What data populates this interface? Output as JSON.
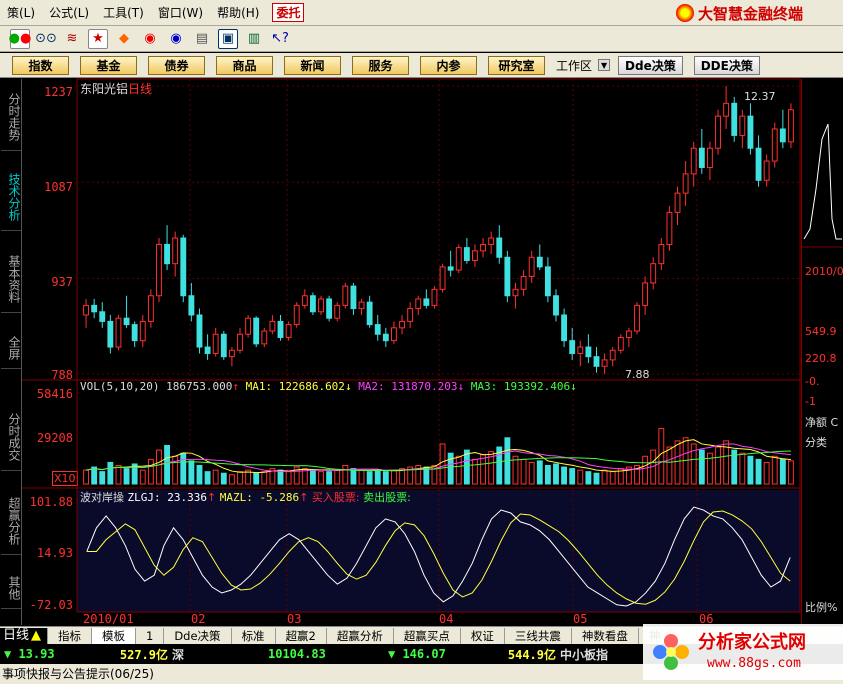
{
  "menubar": {
    "items": [
      "策(L)",
      "公式(L)",
      "工具(T)",
      "窗口(W)",
      "帮助(H)"
    ],
    "entrust": "委托",
    "brand": "大智慧金融终端"
  },
  "toolbar": {
    "icons": [
      "rgb-icon",
      "binoculars-icon",
      "signal-icon",
      "star-icon",
      "diamond-icon",
      "red-circle-icon",
      "blue-circle-icon",
      "book-icon",
      "window-icon",
      "cards-icon",
      "help-icon"
    ]
  },
  "navbar": {
    "buttons": [
      "指数",
      "基金",
      "债券",
      "商品",
      "新闻",
      "服务",
      "内参",
      "研究室"
    ],
    "workzone": "工作区",
    "dde1": "Dde决策",
    "dde2": "DDE决策"
  },
  "sidebar": {
    "tabs": [
      {
        "label": "分时走势",
        "active": false
      },
      {
        "label": "技术分析",
        "active": true
      },
      {
        "label": "基本资料",
        "active": false
      },
      {
        "label": "全屏",
        "active": false
      },
      {
        "label": "分时成交",
        "active": false
      },
      {
        "label": "超赢分析",
        "active": false
      },
      {
        "label": "其他",
        "active": false
      }
    ]
  },
  "stock": {
    "name": "东阳光铝",
    "period": "日线",
    "high_label": "12.37",
    "low_label": "7.88"
  },
  "price_axis": [
    "1237",
    "1087",
    "937",
    "788"
  ],
  "vol_axis": [
    "58416",
    "29208"
  ],
  "vol_unit": "X10",
  "ind_axis": [
    "101.88",
    "14.93",
    "-72.03"
  ],
  "vol_legend": {
    "name": "VOL(5,10,20)",
    "value": "186753.000",
    "ma1": "MA1: 122686.602",
    "ma2": "MA2: 131870.203",
    "ma3": "MA3: 193392.406",
    "up": "↑",
    "down": "↓"
  },
  "ind_legend": {
    "name": "波对岸操",
    "zlgj": "ZLGJ: 23.336",
    "mazl": "MAZL: -5.286",
    "buy": "买入股票:",
    "sell": "卖出股票:",
    "up": "↑"
  },
  "xaxis": [
    "2010/01",
    "02",
    "03",
    "04",
    "05",
    "06"
  ],
  "rightpanel": {
    "date": "2010/0",
    "v1": "549.9",
    "v2": "220.8",
    "v3": "-0.",
    "v4": "-1",
    "net": "净额 C",
    "cls": "分类",
    "ratio": "比例%"
  },
  "bottomtabs": {
    "dayline": "日线",
    "items": [
      "指标",
      "模板",
      "1",
      "Dde决策",
      "标准",
      "超赢2",
      "超赢分析",
      "超赢买点",
      "权证",
      "三线共震",
      "神数看盘",
      "神"
    ]
  },
  "statusbar": {
    "v1": "▼ 13.93",
    "v2": "527.9亿",
    "m1": "深",
    "v3": "10104.83",
    "v4": "▼ 146.07",
    "v5": "544.9亿",
    "m2": "中小板指"
  },
  "notice": "事项快报与公告提示(06/25)",
  "watermark": {
    "title": "分析家公式网",
    "url": "www.88gs.com"
  },
  "chart_data": {
    "type": "candlestick",
    "title": "东阳光铝 日线",
    "ylim": [
      788,
      1237
    ],
    "price_high": 12.37,
    "price_low": 7.88,
    "x_tick_labels": [
      "2010/01",
      "02",
      "03",
      "04",
      "05",
      "06"
    ],
    "ohlc": [
      [
        880,
        905,
        860,
        895
      ],
      [
        895,
        905,
        875,
        885
      ],
      [
        885,
        900,
        860,
        870
      ],
      [
        870,
        880,
        820,
        830
      ],
      [
        830,
        880,
        825,
        875
      ],
      [
        875,
        910,
        860,
        865
      ],
      [
        865,
        870,
        830,
        840
      ],
      [
        840,
        880,
        830,
        870
      ],
      [
        870,
        920,
        860,
        910
      ],
      [
        910,
        1000,
        900,
        990
      ],
      [
        990,
        1020,
        950,
        960
      ],
      [
        960,
        1010,
        940,
        1000
      ],
      [
        1000,
        1005,
        900,
        910
      ],
      [
        910,
        930,
        870,
        880
      ],
      [
        880,
        890,
        820,
        830
      ],
      [
        830,
        850,
        810,
        820
      ],
      [
        820,
        860,
        815,
        850
      ],
      [
        850,
        855,
        810,
        815
      ],
      [
        815,
        830,
        800,
        825
      ],
      [
        825,
        860,
        820,
        850
      ],
      [
        850,
        880,
        845,
        875
      ],
      [
        875,
        878,
        830,
        835
      ],
      [
        835,
        860,
        830,
        855
      ],
      [
        855,
        880,
        850,
        870
      ],
      [
        870,
        880,
        840,
        845
      ],
      [
        845,
        870,
        840,
        865
      ],
      [
        865,
        900,
        860,
        895
      ],
      [
        895,
        920,
        890,
        910
      ],
      [
        910,
        915,
        880,
        885
      ],
      [
        885,
        910,
        880,
        905
      ],
      [
        905,
        910,
        870,
        875
      ],
      [
        875,
        900,
        870,
        895
      ],
      [
        895,
        930,
        890,
        925
      ],
      [
        925,
        930,
        880,
        890
      ],
      [
        890,
        905,
        880,
        900
      ],
      [
        900,
        910,
        860,
        865
      ],
      [
        865,
        880,
        840,
        850
      ],
      [
        850,
        860,
        830,
        840
      ],
      [
        840,
        870,
        835,
        860
      ],
      [
        860,
        880,
        850,
        870
      ],
      [
        870,
        900,
        860,
        890
      ],
      [
        890,
        910,
        880,
        905
      ],
      [
        905,
        920,
        890,
        895
      ],
      [
        895,
        925,
        890,
        920
      ],
      [
        920,
        960,
        915,
        955
      ],
      [
        955,
        980,
        940,
        950
      ],
      [
        950,
        990,
        945,
        985
      ],
      [
        985,
        1000,
        960,
        965
      ],
      [
        965,
        990,
        955,
        980
      ],
      [
        980,
        1000,
        970,
        990
      ],
      [
        990,
        1010,
        975,
        1000
      ],
      [
        1000,
        1020,
        960,
        970
      ],
      [
        970,
        980,
        900,
        910
      ],
      [
        910,
        930,
        890,
        920
      ],
      [
        920,
        950,
        910,
        940
      ],
      [
        940,
        980,
        930,
        970
      ],
      [
        970,
        990,
        950,
        955
      ],
      [
        955,
        970,
        900,
        910
      ],
      [
        910,
        920,
        870,
        880
      ],
      [
        880,
        890,
        830,
        840
      ],
      [
        840,
        860,
        810,
        820
      ],
      [
        820,
        840,
        800,
        830
      ],
      [
        830,
        850,
        805,
        815
      ],
      [
        815,
        830,
        790,
        800
      ],
      [
        800,
        820,
        788,
        810
      ],
      [
        810,
        830,
        800,
        825
      ],
      [
        825,
        850,
        820,
        845
      ],
      [
        845,
        860,
        830,
        855
      ],
      [
        855,
        900,
        850,
        895
      ],
      [
        895,
        940,
        880,
        930
      ],
      [
        930,
        970,
        920,
        960
      ],
      [
        960,
        1000,
        950,
        990
      ],
      [
        990,
        1050,
        980,
        1040
      ],
      [
        1040,
        1080,
        1020,
        1070
      ],
      [
        1070,
        1120,
        1050,
        1100
      ],
      [
        1100,
        1150,
        1080,
        1140
      ],
      [
        1140,
        1170,
        1100,
        1110
      ],
      [
        1110,
        1150,
        1090,
        1140
      ],
      [
        1140,
        1200,
        1130,
        1190
      ],
      [
        1190,
        1237,
        1170,
        1210
      ],
      [
        1210,
        1220,
        1150,
        1160
      ],
      [
        1160,
        1200,
        1140,
        1190
      ],
      [
        1190,
        1210,
        1130,
        1140
      ],
      [
        1140,
        1160,
        1080,
        1090
      ],
      [
        1090,
        1130,
        1080,
        1120
      ],
      [
        1120,
        1180,
        1110,
        1170
      ],
      [
        1170,
        1200,
        1140,
        1150
      ],
      [
        1150,
        1210,
        1140,
        1200
      ]
    ],
    "volume": {
      "ylim": [
        0,
        58416
      ],
      "values": [
        9000,
        11000,
        8000,
        14000,
        12000,
        10000,
        13000,
        9000,
        16000,
        22000,
        25000,
        18000,
        20000,
        15000,
        12000,
        8000,
        9000,
        7000,
        6000,
        8000,
        9000,
        7000,
        8000,
        10000,
        9000,
        8000,
        11000,
        10000,
        9000,
        8000,
        8000,
        9000,
        12000,
        10000,
        9000,
        8000,
        9000,
        8000,
        9000,
        10000,
        11000,
        12000,
        11000,
        12000,
        26000,
        20000,
        18000,
        22000,
        16000,
        19000,
        21000,
        24000,
        30000,
        18000,
        16000,
        14000,
        15000,
        12000,
        13000,
        11000,
        10000,
        9000,
        8000,
        7000,
        9000,
        8000,
        10000,
        11000,
        12000,
        18000,
        22000,
        36000,
        24000,
        28000,
        30000,
        26000,
        22000,
        20000,
        24000,
        28000,
        22000,
        20000,
        18000,
        16000,
        14000,
        18000,
        16000,
        15000
      ]
    },
    "indicator": {
      "name": "波对岸操",
      "ylim": [
        -72.03,
        101.88
      ],
      "zlgj": [
        20,
        60,
        80,
        60,
        30,
        -10,
        -30,
        -20,
        30,
        60,
        40,
        10,
        -20,
        -40,
        -50,
        -45,
        -35,
        -20,
        0,
        20,
        40,
        50,
        40,
        20,
        0,
        -20,
        -35,
        -25,
        0,
        30,
        60,
        75,
        70,
        50,
        20,
        -20,
        -50,
        -65,
        -55,
        -30,
        0,
        40,
        75,
        90,
        85,
        70,
        65,
        55,
        40,
        20,
        0,
        -20,
        -40,
        -50,
        -60,
        -70,
        -72,
        -65,
        -50,
        -30,
        0,
        40,
        75,
        95,
        90,
        80,
        75,
        60,
        40,
        10,
        -20,
        -40,
        -30,
        10
      ]
    }
  }
}
